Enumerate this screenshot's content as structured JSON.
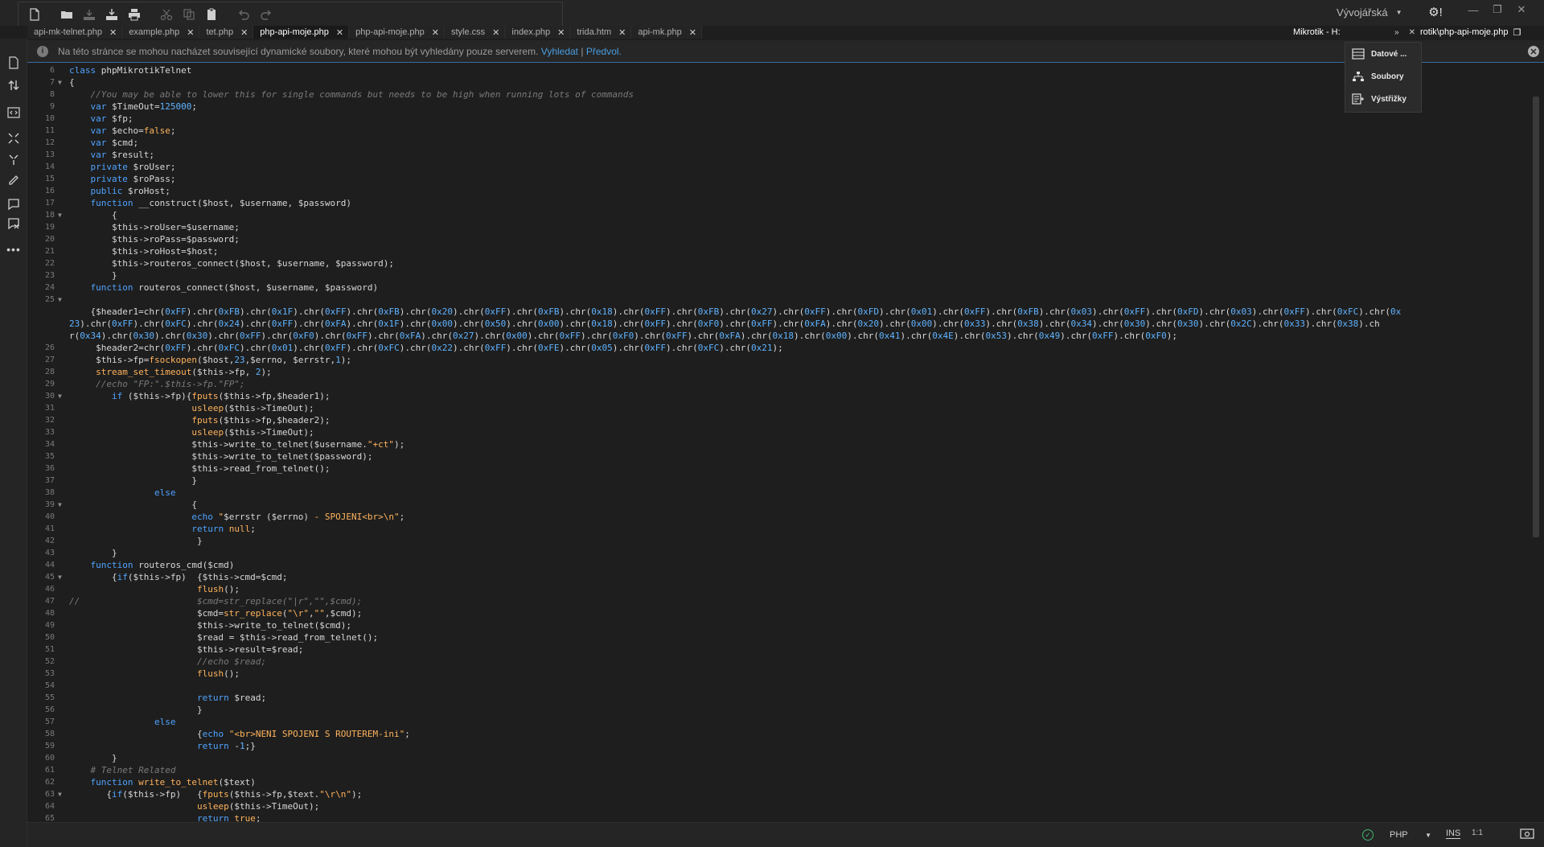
{
  "toolbar": {
    "workspace_label": "Vývojářská",
    "settings_label": "⚙!"
  },
  "tabs": [
    {
      "label": "api-mk-telnet.php",
      "active": false
    },
    {
      "label": "example.php",
      "active": false
    },
    {
      "label": "tet.php",
      "active": false
    },
    {
      "label": "php-api-moje.php",
      "active": true
    },
    {
      "label": "php-api-moje.php",
      "active": false
    },
    {
      "label": "style.css",
      "active": false
    },
    {
      "label": "index.php",
      "active": false
    },
    {
      "label": "trida.htm",
      "active": false
    },
    {
      "label": "api-mk.php",
      "active": false
    }
  ],
  "tab_right": {
    "title": "Mikrotik - H:",
    "path": "rotik\\php-api-moje.php"
  },
  "infobar": {
    "message": "Na této stránce se mohou nacházet související dynamické soubory, které mohou být vyhledány pouze serverem.",
    "link_search": "Vyhledat",
    "separator": "|",
    "link_prefs": "Předvol."
  },
  "panel": {
    "items": [
      {
        "label": "Datové ...",
        "icon": "database-icon"
      },
      {
        "label": "Soubory",
        "icon": "file-tree-icon"
      },
      {
        "label": "Výstřižky",
        "icon": "snippets-icon"
      }
    ]
  },
  "status": {
    "language": "PHP",
    "mode": "INS",
    "position": "1:1"
  },
  "editor": {
    "lines": [
      {
        "n": "6",
        "fold": "",
        "html": "<span class='kw'>class</span> phpMikrotikTelnet"
      },
      {
        "n": "7",
        "fold": "▼",
        "html": "{"
      },
      {
        "n": "8",
        "fold": "",
        "html": "    <span class='cm'>//You may be able to lower this for single commands but needs to be high when running lots of commands</span>"
      },
      {
        "n": "9",
        "fold": "",
        "html": "    <span class='kw'>var</span> $TimeOut=<span class='num'>125000</span>;"
      },
      {
        "n": "10",
        "fold": "",
        "html": "    <span class='kw'>var</span> $fp;"
      },
      {
        "n": "11",
        "fold": "",
        "html": "    <span class='kw'>var</span> $echo=<span class='fn'>false</span>;"
      },
      {
        "n": "12",
        "fold": "",
        "html": "    <span class='kw'>var</span> $cmd;"
      },
      {
        "n": "13",
        "fold": "",
        "html": "    <span class='kw'>var</span> $result;"
      },
      {
        "n": "14",
        "fold": "",
        "html": "    <span class='kw'>private</span> $roUser;"
      },
      {
        "n": "15",
        "fold": "",
        "html": "    <span class='kw'>private</span> $roPass;"
      },
      {
        "n": "16",
        "fold": "",
        "html": "    <span class='kw'>public</span> $roHost;"
      },
      {
        "n": "17",
        "fold": "",
        "html": "    <span class='kw'>function</span> __construct($host, $username, $password)"
      },
      {
        "n": "18",
        "fold": "▼",
        "html": "        {"
      },
      {
        "n": "19",
        "fold": "",
        "html": "        $this->roUser=$username;"
      },
      {
        "n": "20",
        "fold": "",
        "html": "        $this->roPass=$password;"
      },
      {
        "n": "21",
        "fold": "",
        "html": "        $this->roHost=$host;"
      },
      {
        "n": "22",
        "fold": "",
        "html": "        $this->routeros_connect($host, $username, $password);"
      },
      {
        "n": "23",
        "fold": "",
        "html": "        }"
      },
      {
        "n": "24",
        "fold": "",
        "html": "    <span class='kw'>function</span> routeros_connect($host, $username, $password)"
      },
      {
        "n": "25",
        "fold": "▼",
        "html": ""
      },
      {
        "n": "",
        "fold": "",
        "html": "    {$header1=chr(<span class='hx'>0xFF</span>).chr(<span class='hx'>0xFB</span>).chr(<span class='hx'>0x1F</span>).chr(<span class='hx'>0xFF</span>).chr(<span class='hx'>0xFB</span>).chr(<span class='hx'>0x20</span>).chr(<span class='hx'>0xFF</span>).chr(<span class='hx'>0xFB</span>).chr(<span class='hx'>0x18</span>).chr(<span class='hx'>0xFF</span>).chr(<span class='hx'>0xFB</span>).chr(<span class='hx'>0x27</span>).chr(<span class='hx'>0xFF</span>).chr(<span class='hx'>0xFD</span>).chr(<span class='hx'>0x01</span>).chr(<span class='hx'>0xFF</span>).chr(<span class='hx'>0xFB</span>).chr(<span class='hx'>0x03</span>).chr(<span class='hx'>0xFF</span>).chr(<span class='hx'>0xFD</span>).chr(<span class='hx'>0x03</span>).chr(<span class='hx'>0xFF</span>).chr(<span class='hx'>0xFC</span>).chr(<span class='hx'>0x</span>"
      },
      {
        "n": "",
        "fold": "",
        "html": "<span class='hx'>23</span>).chr(<span class='hx'>0xFF</span>).chr(<span class='hx'>0xFC</span>).chr(<span class='hx'>0x24</span>).chr(<span class='hx'>0xFF</span>).chr(<span class='hx'>0xFA</span>).chr(<span class='hx'>0x1F</span>).chr(<span class='hx'>0x00</span>).chr(<span class='hx'>0x50</span>).chr(<span class='hx'>0x00</span>).chr(<span class='hx'>0x18</span>).chr(<span class='hx'>0xFF</span>).chr(<span class='hx'>0xF0</span>).chr(<span class='hx'>0xFF</span>).chr(<span class='hx'>0xFA</span>).chr(<span class='hx'>0x20</span>).chr(<span class='hx'>0x00</span>).chr(<span class='hx'>0x33</span>).chr(<span class='hx'>0x38</span>).chr(<span class='hx'>0x34</span>).chr(<span class='hx'>0x30</span>).chr(<span class='hx'>0x30</span>).chr(<span class='hx'>0x2C</span>).chr(<span class='hx'>0x33</span>).chr(<span class='hx'>0x38</span>).ch"
      },
      {
        "n": "",
        "fold": "",
        "html": "r(<span class='hx'>0x34</span>).chr(<span class='hx'>0x30</span>).chr(<span class='hx'>0x30</span>).chr(<span class='hx'>0xFF</span>).chr(<span class='hx'>0xF0</span>).chr(<span class='hx'>0xFF</span>).chr(<span class='hx'>0xFA</span>).chr(<span class='hx'>0x27</span>).chr(<span class='hx'>0x00</span>).chr(<span class='hx'>0xFF</span>).chr(<span class='hx'>0xF0</span>).chr(<span class='hx'>0xFF</span>).chr(<span class='hx'>0xFA</span>).chr(<span class='hx'>0x18</span>).chr(<span class='hx'>0x00</span>).chr(<span class='hx'>0x41</span>).chr(<span class='hx'>0x4E</span>).chr(<span class='hx'>0x53</span>).chr(<span class='hx'>0x49</span>).chr(<span class='hx'>0xFF</span>).chr(<span class='hx'>0xF0</span>);"
      },
      {
        "n": "26",
        "fold": "",
        "html": "     $header2=chr(<span class='hx'>0xFF</span>).chr(<span class='hx'>0xFC</span>).chr(<span class='hx'>0x01</span>).chr(<span class='hx'>0xFF</span>).chr(<span class='hx'>0xFC</span>).chr(<span class='hx'>0x22</span>).chr(<span class='hx'>0xFF</span>).chr(<span class='hx'>0xFE</span>).chr(<span class='hx'>0x05</span>).chr(<span class='hx'>0xFF</span>).chr(<span class='hx'>0xFC</span>).chr(<span class='hx'>0x21</span>);"
      },
      {
        "n": "27",
        "fold": "",
        "html": "     $this->fp=<span class='fn'>fsockopen</span>($host,<span class='num'>23</span>,$errno, $errstr,<span class='num'>1</span>);"
      },
      {
        "n": "28",
        "fold": "",
        "html": "     <span class='fn'>stream_set_timeout</span>($this->fp, <span class='num'>2</span>);"
      },
      {
        "n": "29",
        "fold": "",
        "html": "     <span class='cm'>//echo \"FP:\".$this->fp.\"FP\";</span>"
      },
      {
        "n": "30",
        "fold": "▼",
        "html": "        <span class='kw'>if</span> ($this->fp){<span class='fn'>fputs</span>($this->fp,$header1);"
      },
      {
        "n": "31",
        "fold": "",
        "html": "                       <span class='fn'>usleep</span>($this->TimeOut);"
      },
      {
        "n": "32",
        "fold": "",
        "html": "                       <span class='fn'>fputs</span>($this->fp,$header2);"
      },
      {
        "n": "33",
        "fold": "",
        "html": "                       <span class='fn'>usleep</span>($this->TimeOut);"
      },
      {
        "n": "34",
        "fold": "",
        "html": "                       $this->write_to_telnet($username.<span class='str'>\"+ct\"</span>);"
      },
      {
        "n": "35",
        "fold": "",
        "html": "                       $this->write_to_telnet($password);"
      },
      {
        "n": "36",
        "fold": "",
        "html": "                       $this->read_from_telnet();"
      },
      {
        "n": "37",
        "fold": "",
        "html": "                       }"
      },
      {
        "n": "38",
        "fold": "",
        "html": "                <span class='kw'>else</span>"
      },
      {
        "n": "39",
        "fold": "▼",
        "html": "                       {"
      },
      {
        "n": "40",
        "fold": "",
        "html": "                       <span class='kw'>echo</span> <span class='str'>\"</span>$errstr ($errno)<span class='str'> - SPOJENI&lt;br&gt;\\n\"</span>;"
      },
      {
        "n": "41",
        "fold": "",
        "html": "                       <span class='kw'>return</span> <span class='fn'>null</span>;"
      },
      {
        "n": "42",
        "fold": "",
        "html": "                        }"
      },
      {
        "n": "43",
        "fold": "",
        "html": "        }"
      },
      {
        "n": "44",
        "fold": "",
        "html": "    <span class='kw'>function</span> routeros_cmd($cmd)"
      },
      {
        "n": "45",
        "fold": "▼",
        "html": "        {<span class='kw'>if</span>($this->fp)  {$this->cmd=$cmd;"
      },
      {
        "n": "46",
        "fold": "",
        "html": "                        <span class='fn'>flush</span>();"
      },
      {
        "n": "47",
        "fold": "",
        "html": "<span class='cm'>//                      $cmd=str_replace(\"|r\",\"\",$cmd);</span>"
      },
      {
        "n": "48",
        "fold": "",
        "html": "                        $cmd=<span class='fn'>str_replace</span>(<span class='str'>\"\\r\"</span>,<span class='str'>\"\"</span>,$cmd);"
      },
      {
        "n": "49",
        "fold": "",
        "html": "                        $this->write_to_telnet($cmd);"
      },
      {
        "n": "50",
        "fold": "",
        "html": "                        $read = $this->read_from_telnet();"
      },
      {
        "n": "51",
        "fold": "",
        "html": "                        $this->result=$read;"
      },
      {
        "n": "52",
        "fold": "",
        "html": "                        <span class='cm'>//echo $read;</span>"
      },
      {
        "n": "53",
        "fold": "",
        "html": "                        <span class='fn'>flush</span>();"
      },
      {
        "n": "54",
        "fold": "",
        "html": ""
      },
      {
        "n": "55",
        "fold": "",
        "html": "                        <span class='kw'>return</span> $read;"
      },
      {
        "n": "56",
        "fold": "",
        "html": "                        }"
      },
      {
        "n": "57",
        "fold": "",
        "html": "                <span class='kw'>else</span>"
      },
      {
        "n": "58",
        "fold": "",
        "html": "                        {<span class='kw'>echo</span> <span class='str'>\"&lt;br&gt;NENI SPOJENI S ROUTEREM-ini\"</span>;"
      },
      {
        "n": "59",
        "fold": "",
        "html": "                        <span class='kw'>return</span> -<span class='num'>1</span>;}"
      },
      {
        "n": "60",
        "fold": "",
        "html": "        }"
      },
      {
        "n": "61",
        "fold": "",
        "html": "    <span class='cm'># Telnet Related</span>"
      },
      {
        "n": "62",
        "fold": "",
        "html": "    <span class='kw'>function</span> <span class='fn'>write_to_telnet</span>($text)"
      },
      {
        "n": "63",
        "fold": "▼",
        "html": "       {<span class='kw'>if</span>($this->fp)   {<span class='fn'>fputs</span>($this->fp,$text.<span class='str'>\"\\r\\n\"</span>);"
      },
      {
        "n": "64",
        "fold": "",
        "html": "                        <span class='fn'>usleep</span>($this->TimeOut);"
      },
      {
        "n": "65",
        "fold": "",
        "html": "                        <span class='kw'>return</span> <span class='fn'>true</span>;"
      }
    ]
  }
}
